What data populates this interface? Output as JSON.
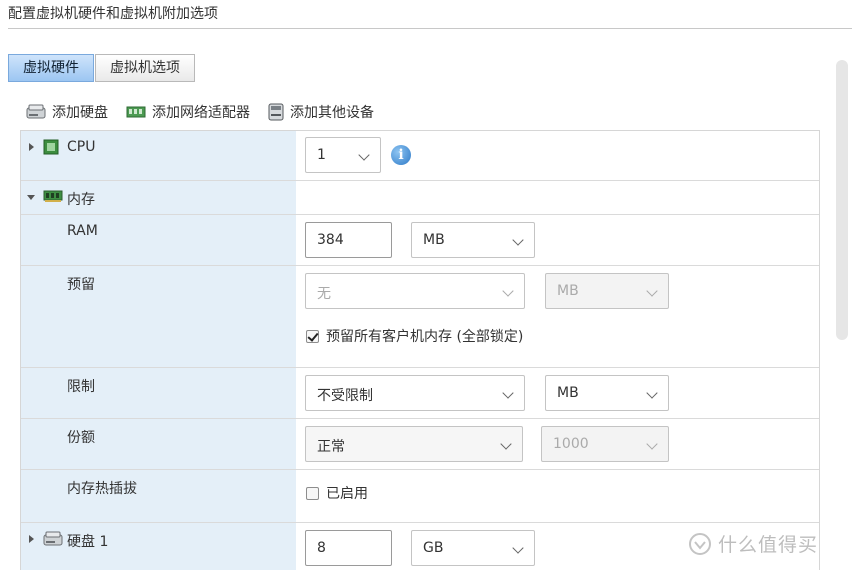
{
  "header": {
    "title": "配置虚拟机硬件和虚拟机附加选项"
  },
  "tabs": [
    {
      "label": "虚拟硬件",
      "active": true
    },
    {
      "label": "虚拟机选项",
      "active": false
    }
  ],
  "toolbar": {
    "add_disk": "添加硬盘",
    "add_nic": "添加网络适配器",
    "add_other": "添加其他设备"
  },
  "rows": {
    "cpu": {
      "label": "CPU",
      "value": "1"
    },
    "memory": {
      "label": "内存"
    },
    "ram": {
      "label": "RAM",
      "value": "384",
      "unit": "MB"
    },
    "reservation": {
      "label": "预留",
      "value": "无",
      "unit": "MB",
      "reserve_all_label": "预留所有客户机内存 (全部锁定)",
      "reserve_all_checked": true
    },
    "limit": {
      "label": "限制",
      "value": "不受限制",
      "unit": "MB"
    },
    "shares": {
      "label": "份额",
      "value": "正常",
      "amount": "1000"
    },
    "hotplug": {
      "label": "内存热插拔",
      "option_label": "已启用",
      "checked": false
    },
    "disk1": {
      "label": "硬盘 1",
      "value": "8",
      "unit": "GB"
    }
  },
  "watermark": {
    "text": "什么值得买"
  },
  "colors": {
    "accent": "#9cc6f2",
    "left_column_bg": "#e4eff8",
    "info_icon": "#2d79c7"
  }
}
